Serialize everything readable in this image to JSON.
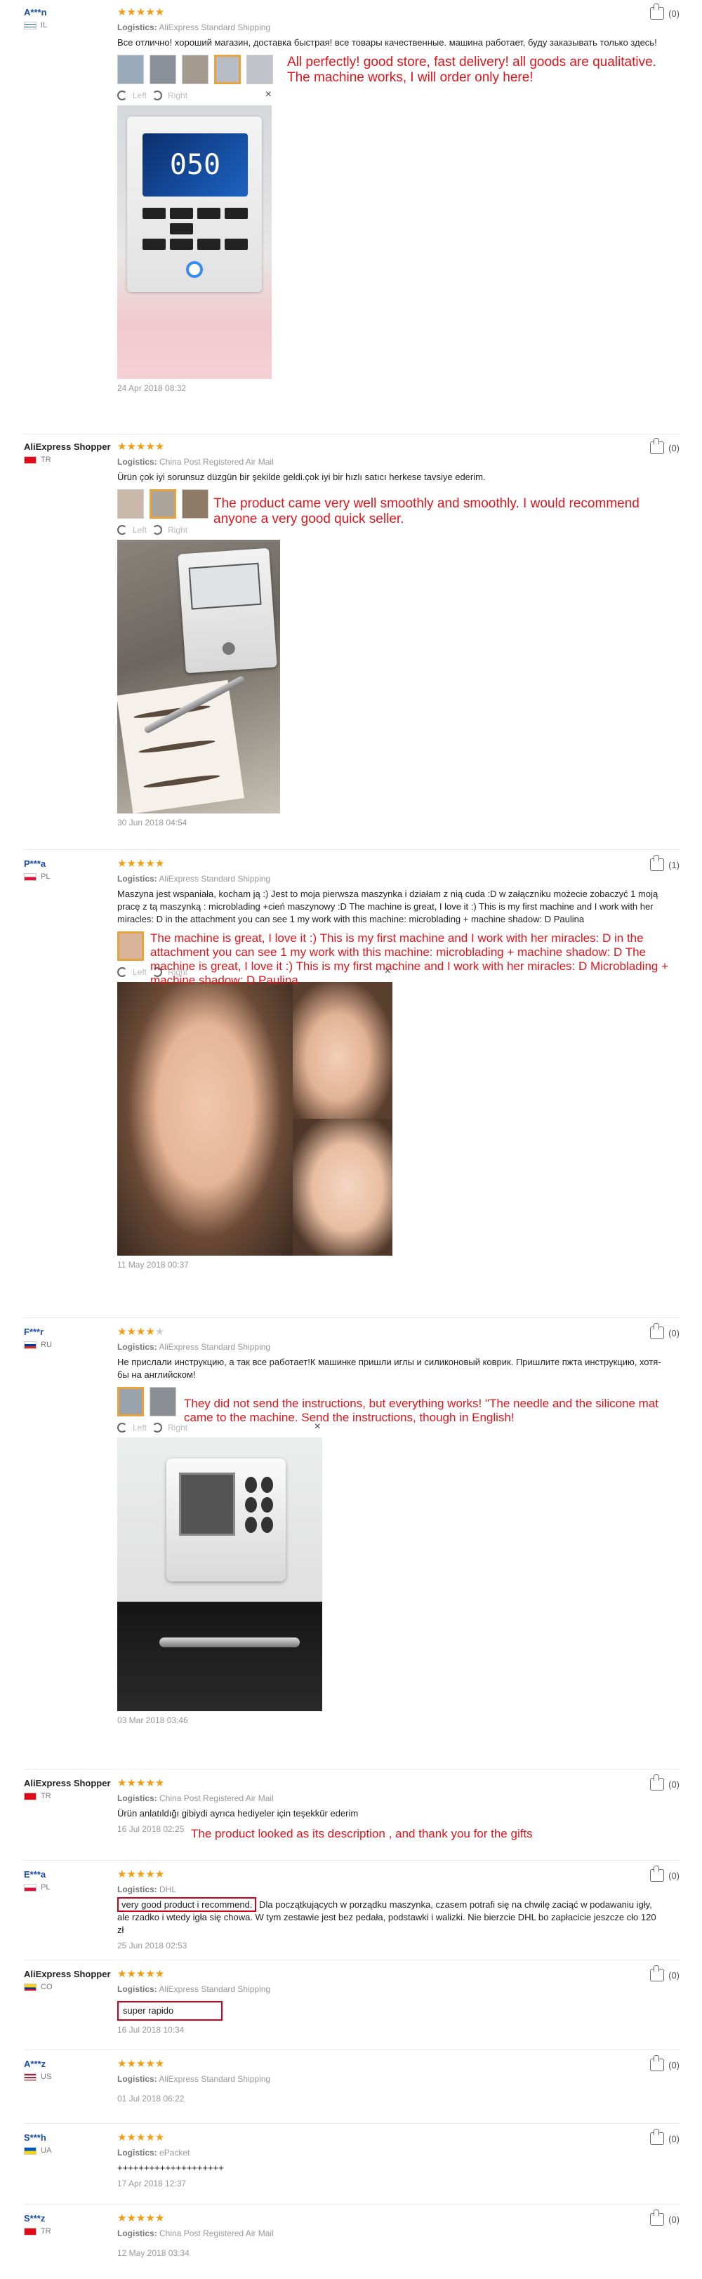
{
  "reviews": [
    {
      "user": "A***n",
      "country": "IL",
      "stars": 5,
      "helpful": "(0)",
      "logistics_label": "Logistics:",
      "logistics": "AliExpress Standard Shipping",
      "text": "Все отлично! хороший магазин, доставка быстрая! все товары качественные. машина работает, буду заказывать только здесь!",
      "translation": "All perfectly! good store, fast delivery! all goods are qualitative. The machine works, I will order only here!",
      "rotate_left": "Left",
      "rotate_right": "Right",
      "device_screen": "050",
      "date": "24 Apr 2018 08:32"
    },
    {
      "user": "AliExpress Shopper",
      "country": "TR",
      "stars": 5,
      "helpful": "(0)",
      "logistics_label": "Logistics:",
      "logistics": "China Post Registered Air Mail",
      "text": "Ürün çok iyi sorunsuz düzgün bir şekilde geldi.çok iyi bir hızlı satıcı herkese tavsiye ederim.",
      "translation": "The product came very well smoothly and smoothly. I would recommend anyone a very good quick seller.",
      "rotate_left": "Left",
      "rotate_right": "Right",
      "date": "30 Jun 2018 04:54"
    },
    {
      "user": "P***a",
      "country": "PL",
      "stars": 5,
      "helpful": "(1)",
      "logistics_label": "Logistics:",
      "logistics": "AliExpress Standard Shipping",
      "text": "Maszyna jest wspaniała, kocham ją :) Jest to moja pierwsza maszynka i działam z nią cuda :D w załączniku możecie zobaczyć 1 moją pracę z tą maszynką : microblading +cień maszynowy :D The machine is great, I love it :) This is my first machine and I work with her miracles: D in the attachment you can see 1 my work with this machine: microblading + machine shadow: D Paulina",
      "translation": "The machine is great, I love it :) This is my first machine and I work with her miracles: D in the attachment you can see 1 my work with this machine: microblading + machine shadow: D The machine is great, I love it :) This is my first machine and I work with her miracles: D Microblading + machine shadow: D Paulina",
      "rotate_left": "Left",
      "rotate_right": "Right",
      "date": "11 May 2018 00:37"
    },
    {
      "user": "F***r",
      "country": "RU",
      "stars": 4,
      "helpful": "(0)",
      "logistics_label": "Logistics:",
      "logistics": "AliExpress Standard Shipping",
      "text": "Не прислали инструкцию, а так все работает!К машинке пришли иглы и силиконовый коврик. Пришлите пжта инструкцию, хотя-бы на английском!",
      "translation": "They did not send the instructions, but everything works! \"The needle and the silicone mat came to the machine. Send the instructions, though in English!",
      "rotate_left": "Left",
      "rotate_right": "Right",
      "date": "03 Mar 2018 03:46"
    },
    {
      "user": "AliExpress Shopper",
      "country": "TR",
      "stars": 5,
      "helpful": "(0)",
      "logistics_label": "Logistics:",
      "logistics": "China Post Registered Air Mail",
      "text": "Ürün anlatıldığı gibiydi ayrıca hediyeler için teşekkür ederim",
      "translation": "The product looked as its description , and thank you for the gifts",
      "date": "16 Jul 2018 02:25"
    },
    {
      "user": "E***a",
      "country": "PL",
      "stars": 5,
      "helpful": "(0)",
      "logistics_label": "Logistics:",
      "logistics": "DHL",
      "text_highlight": "very good product i recommend.",
      "text": " Dla początkujących w porządku maszynka, czasem potrafi się na chwilę zaciąć w podawaniu igły, ale rzadko i wtedy igła się chowa. W tym zestawie jest bez pedała, podstawki i walizki. Nie bierzcie DHL bo zapłacicie jeszcze cło 120 zł",
      "date": "25 Jun 2018 02:53"
    },
    {
      "user": "AliExpress Shopper",
      "country": "CO",
      "stars": 5,
      "helpful": "(0)",
      "logistics_label": "Logistics:",
      "logistics": "AliExpress Standard Shipping",
      "text_highlight": "super rapido",
      "date": "16 Jul 2018 10:34"
    },
    {
      "user": "A***z",
      "country": "US",
      "stars": 5,
      "helpful": "(0)",
      "logistics_label": "Logistics:",
      "logistics": "AliExpress Standard Shipping",
      "date": "01 Jul 2018 06:22"
    },
    {
      "user": "S***h",
      "country": "UA",
      "stars": 5,
      "helpful": "(0)",
      "logistics_label": "Logistics:",
      "logistics": "ePacket",
      "text": "++++++++++++++++++++",
      "date": "17 Apr 2018 12:37"
    },
    {
      "user": "S***z",
      "country": "TR",
      "stars": 5,
      "helpful": "(0)",
      "logistics_label": "Logistics:",
      "logistics": "China Post Registered Air Mail",
      "date": "12 May 2018 03:34"
    }
  ],
  "colors": {
    "stars": "#f39c12",
    "username": "#1a4fa8",
    "translation": "#e0161c",
    "highlight_box": "#d0021b"
  },
  "icons": {
    "thumbs_up": "thumbs-up-icon",
    "rotate_left": "rotate-left-icon",
    "rotate_right": "rotate-right-icon",
    "close": "close-icon"
  }
}
